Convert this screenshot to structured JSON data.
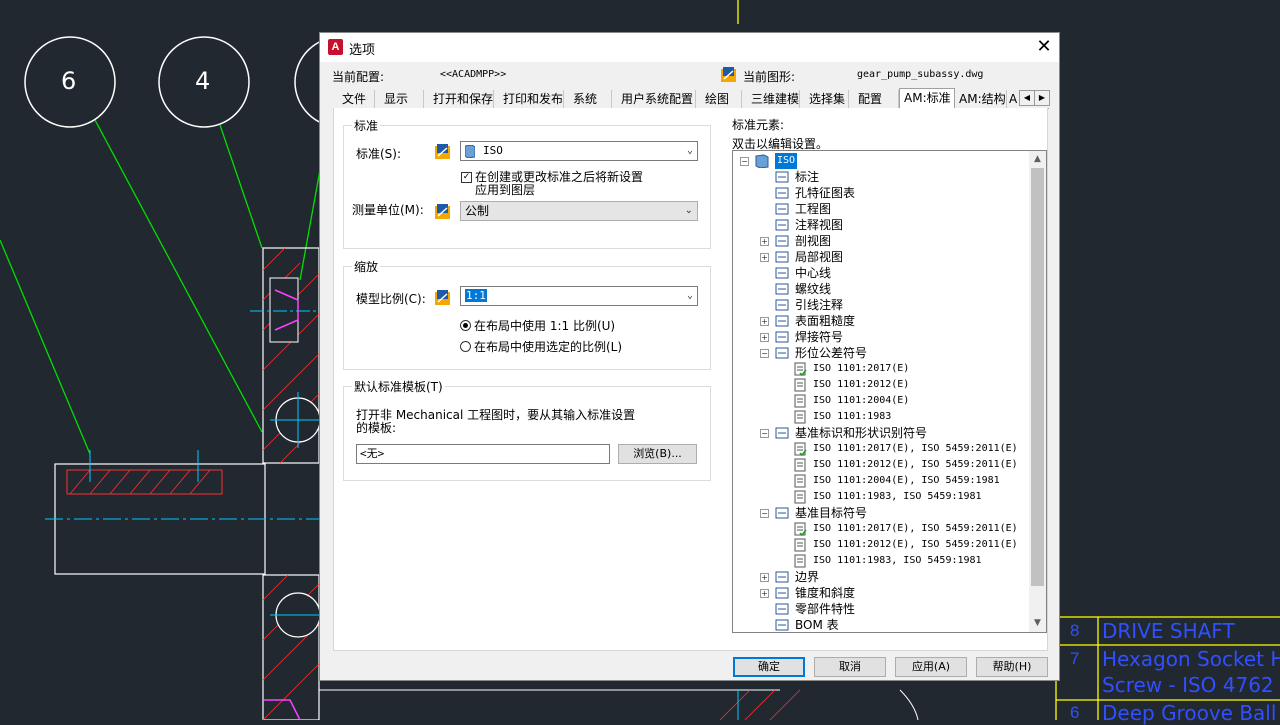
{
  "window_title": "选项",
  "header": {
    "current_profile_label": "当前配置:",
    "current_profile_value": "<<ACADMPP>>",
    "current_drawing_label": "当前图形:",
    "current_drawing_value": "gear_pump_subassy.dwg"
  },
  "tabs": [
    "文件",
    "显示",
    "打开和保存",
    "打印和发布",
    "系统",
    "用户系统配置",
    "绘图",
    "三维建模",
    "选择集",
    "配置",
    "AM:标准",
    "AM:结构",
    "A"
  ],
  "active_tab": "AM:标准",
  "standard_group": {
    "title": "标准",
    "standard_label": "标准(S):",
    "standard_value": "ISO",
    "apply_checkbox_line1": "在创建或更改标准之后将新设置",
    "apply_checkbox_line2": "应用到图层",
    "apply_checked": true,
    "unit_label": "测量单位(M):",
    "unit_value": "公制"
  },
  "scale_group": {
    "title": "缩放",
    "model_scale_label": "模型比例(C):",
    "model_scale_value": "1:1",
    "radio1": "在布局中使用 1:1 比例(U)",
    "radio2": "在布局中使用选定的比例(L)",
    "radio_selected": 1
  },
  "template_group": {
    "title": "默认标准模板(T)",
    "desc_line1": "打开非 Mechanical 工程图时，要从其输入标准设置",
    "desc_line2": "的模板:",
    "template_value": "<无>",
    "browse_label": "浏览(B)..."
  },
  "elements": {
    "title": "标准元素:",
    "hint": "双击以编辑设置。",
    "tree": [
      {
        "label": "ISO",
        "level": 0,
        "expander": "−",
        "icon": "standard-icon",
        "selected": true
      },
      {
        "label": "标注",
        "level": 1,
        "expander": "",
        "icon": "dimension-icon"
      },
      {
        "label": "孔特征图表",
        "level": 1,
        "expander": "",
        "icon": "hole-chart-icon"
      },
      {
        "label": "工程图",
        "level": 1,
        "expander": "",
        "icon": "drawing-icon"
      },
      {
        "label": "注释视图",
        "level": 1,
        "expander": "",
        "icon": "annotation-view-icon"
      },
      {
        "label": "剖视图",
        "level": 1,
        "expander": "+",
        "icon": "section-view-icon"
      },
      {
        "label": "局部视图",
        "level": 1,
        "expander": "+",
        "icon": "detail-view-icon"
      },
      {
        "label": "中心线",
        "level": 1,
        "expander": "",
        "icon": "centerline-icon"
      },
      {
        "label": "螺纹线",
        "level": 1,
        "expander": "",
        "icon": "thread-icon"
      },
      {
        "label": "引线注释",
        "level": 1,
        "expander": "",
        "icon": "leader-icon"
      },
      {
        "label": "表面粗糙度",
        "level": 1,
        "expander": "+",
        "icon": "surface-texture-icon"
      },
      {
        "label": "焊接符号",
        "level": 1,
        "expander": "+",
        "icon": "weld-icon"
      },
      {
        "label": "形位公差符号",
        "level": 1,
        "expander": "−",
        "icon": "fcf-icon"
      },
      {
        "label": "ISO 1101:2017(E)",
        "level": 2,
        "expander": "",
        "icon": "doc-check-icon",
        "code": true
      },
      {
        "label": "ISO 1101:2012(E)",
        "level": 2,
        "expander": "",
        "icon": "doc-icon",
        "code": true
      },
      {
        "label": "ISO 1101:2004(E)",
        "level": 2,
        "expander": "",
        "icon": "doc-icon",
        "code": true
      },
      {
        "label": "ISO 1101:1983",
        "level": 2,
        "expander": "",
        "icon": "doc-icon",
        "code": true
      },
      {
        "label": "基准标识和形状识别符号",
        "level": 1,
        "expander": "−",
        "icon": "datum-id-icon"
      },
      {
        "label": "ISO 1101:2017(E), ISO 5459:2011(E)",
        "level": 2,
        "expander": "",
        "icon": "doc-check-icon",
        "code": true
      },
      {
        "label": "ISO 1101:2012(E), ISO 5459:2011(E)",
        "level": 2,
        "expander": "",
        "icon": "doc-icon",
        "code": true
      },
      {
        "label": "ISO 1101:2004(E), ISO 5459:1981",
        "level": 2,
        "expander": "",
        "icon": "doc-icon",
        "code": true
      },
      {
        "label": "ISO 1101:1983, ISO 5459:1981",
        "level": 2,
        "expander": "",
        "icon": "doc-icon",
        "code": true
      },
      {
        "label": "基准目标符号",
        "level": 1,
        "expander": "−",
        "icon": "datum-target-icon"
      },
      {
        "label": "ISO 1101:2017(E), ISO 5459:2011(E)",
        "level": 2,
        "expander": "",
        "icon": "doc-check-icon",
        "code": true
      },
      {
        "label": "ISO 1101:2012(E), ISO 5459:2011(E)",
        "level": 2,
        "expander": "",
        "icon": "doc-icon",
        "code": true
      },
      {
        "label": "ISO 1101:1983, ISO 5459:1981",
        "level": 2,
        "expander": "",
        "icon": "doc-icon",
        "code": true
      },
      {
        "label": "边界",
        "level": 1,
        "expander": "+",
        "icon": "edge-icon"
      },
      {
        "label": "锥度和斜度",
        "level": 1,
        "expander": "+",
        "icon": "taper-icon"
      },
      {
        "label": "零部件特性",
        "level": 1,
        "expander": "",
        "icon": "part-property-icon"
      },
      {
        "label": "BOM 表",
        "level": 1,
        "expander": "",
        "icon": "bom-icon"
      }
    ]
  },
  "buttons": {
    "ok": "确定",
    "cancel": "取消",
    "apply": "应用(A)",
    "help": "帮助(H)"
  },
  "background": {
    "balloons": [
      "6",
      "4"
    ],
    "bom_rows": [
      {
        "num": "8",
        "desc": "DRIVE SHAFT"
      },
      {
        "num": "7",
        "desc": "Hexagon Socket He"
      },
      {
        "num": "",
        "desc": "Screw - ISO 4762 -"
      },
      {
        "num": "6",
        "desc": "Deep Groove Ball B"
      }
    ]
  },
  "colors": {
    "accent": "#0078d7",
    "cad_bg": "#212830"
  }
}
